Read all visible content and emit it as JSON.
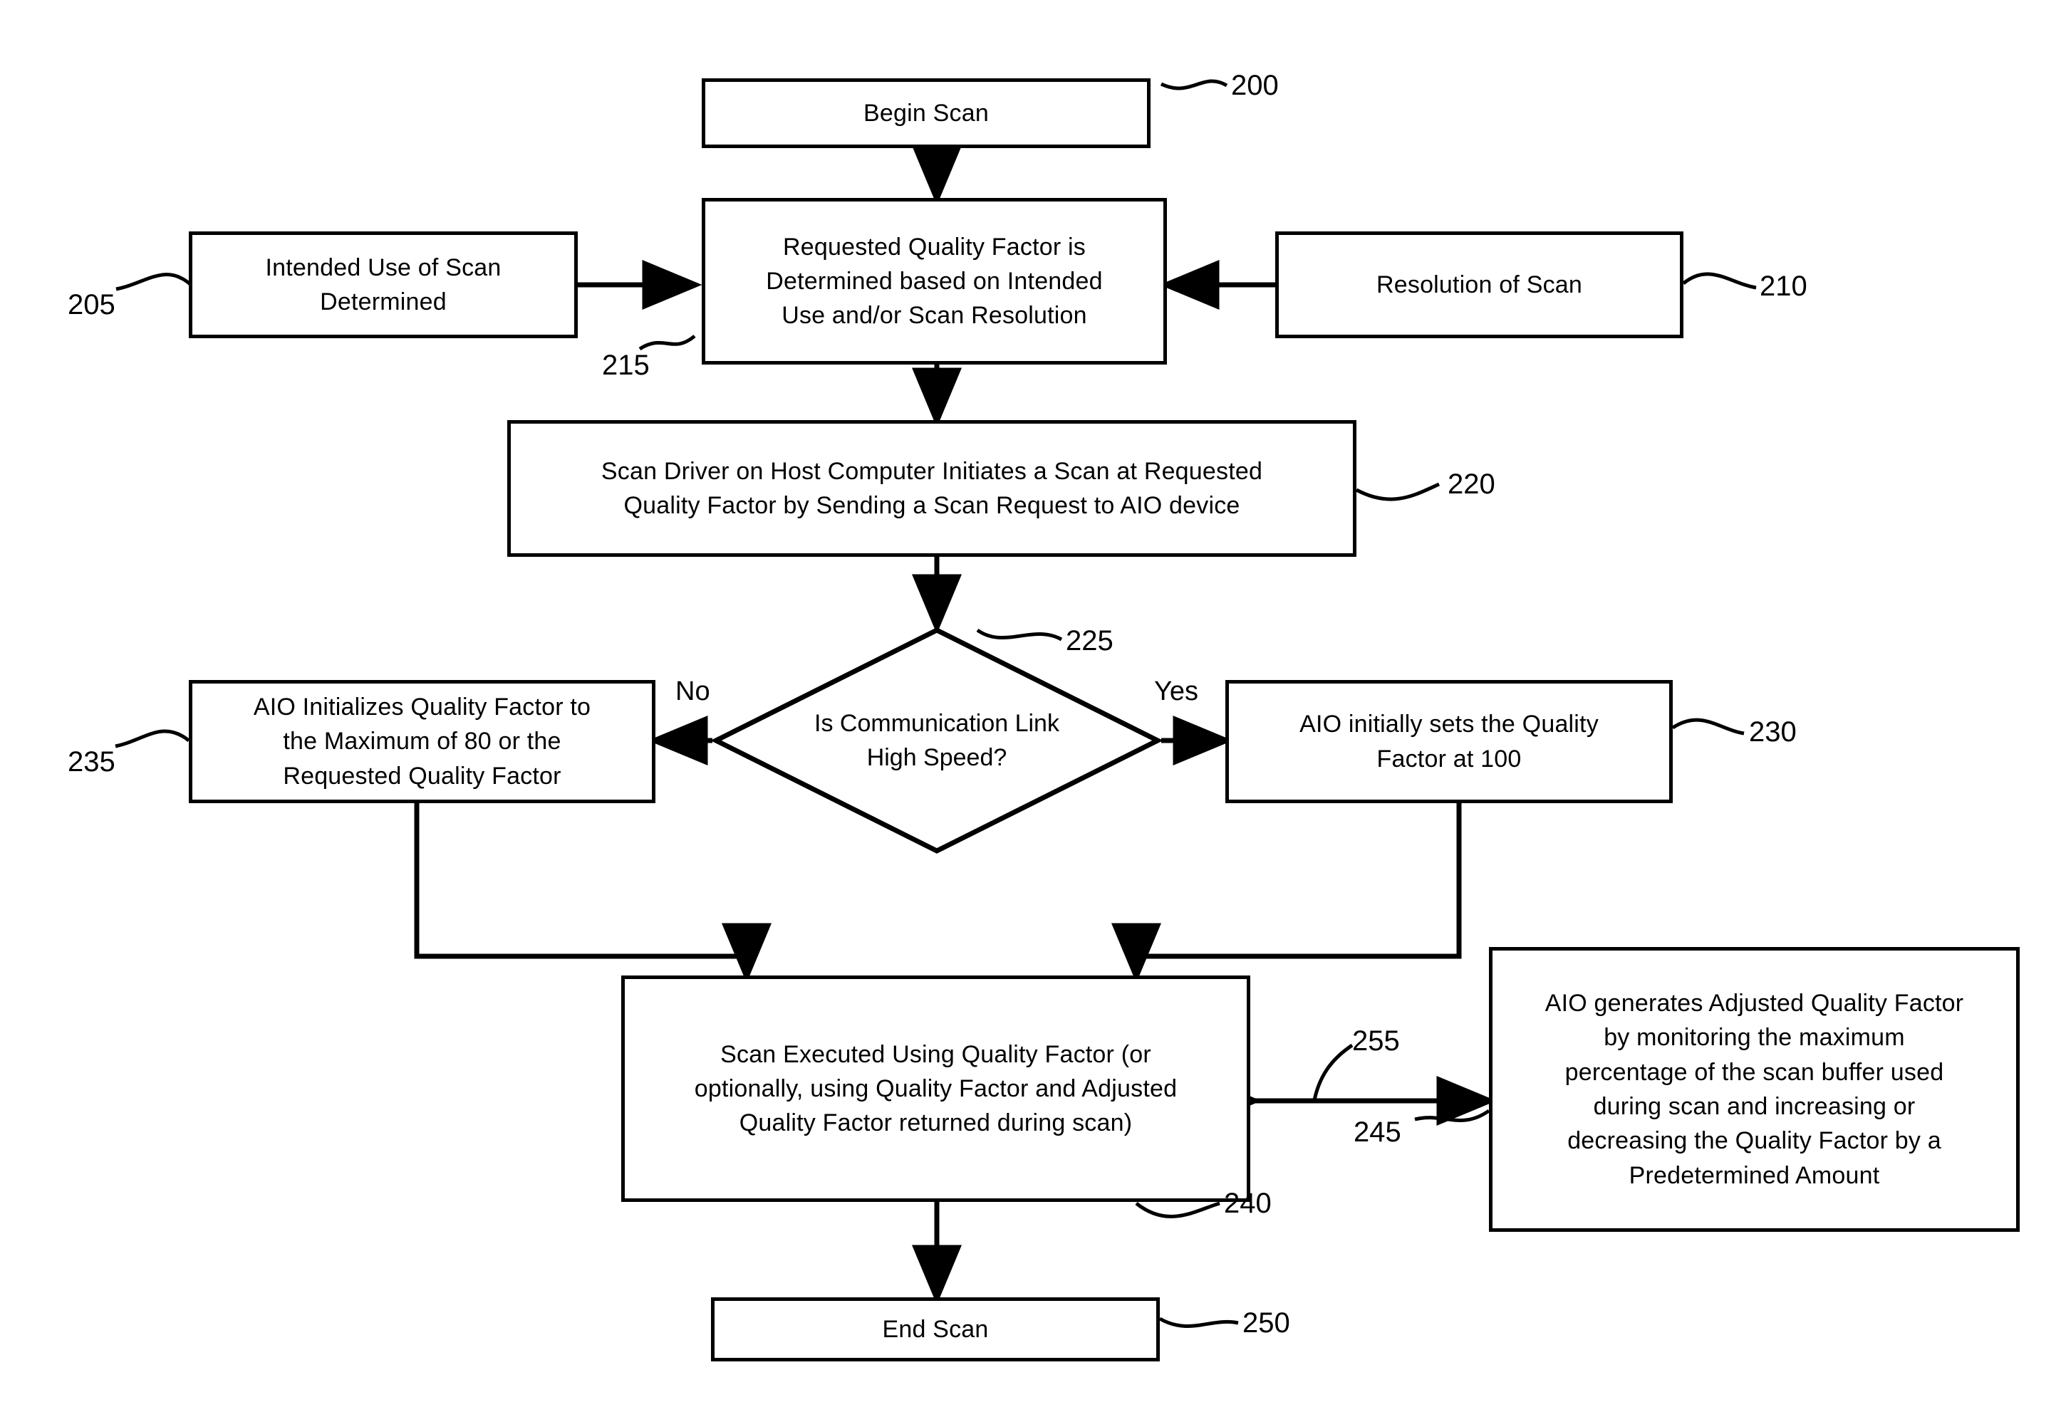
{
  "figure": {
    "type": "patent-flowchart",
    "background": "#ffffff",
    "stroke": "#000000"
  },
  "nodes": {
    "begin_scan": {
      "label": "Begin Scan",
      "ref": "200"
    },
    "intended_use": {
      "label": "Intended Use of Scan\nDetermined",
      "ref": "205"
    },
    "requested_qf": {
      "label": "Requested Quality Factor is\nDetermined based on Intended\nUse and/or Scan Resolution",
      "ref": "215"
    },
    "resolution_of_scan": {
      "label": "Resolution of Scan",
      "ref": "210"
    },
    "scan_driver": {
      "label": "Scan Driver on Host Computer Initiates a Scan at Requested\nQuality Factor by Sending a Scan Request to AIO device",
      "ref": "220"
    },
    "decision_link": {
      "label": "Is Communication Link\nHigh Speed?",
      "ref": "225"
    },
    "aio_init_80": {
      "label": "AIO Initializes Quality Factor to\nthe Maximum of 80 or the\nRequested Quality Factor",
      "ref": "235"
    },
    "aio_set_100": {
      "label": "AIO initially sets the Quality\nFactor at 100",
      "ref": "230"
    },
    "scan_executed": {
      "label": "Scan Executed Using Quality Factor (or\noptionally, using Quality Factor and Adjusted\nQuality Factor returned during scan)",
      "ref": "240"
    },
    "aio_adjusted_qf": {
      "label": "AIO generates Adjusted Quality Factor\nby  monitoring the maximum\npercentage of the scan buffer used\nduring scan and increasing or\ndecreasing the Quality Factor by a\nPredetermined Amount",
      "ref": "245"
    },
    "end_scan": {
      "label": "End Scan",
      "ref": "250"
    }
  },
  "edge_labels": {
    "no": "No",
    "yes": "Yes",
    "feedback_ref": "255"
  }
}
